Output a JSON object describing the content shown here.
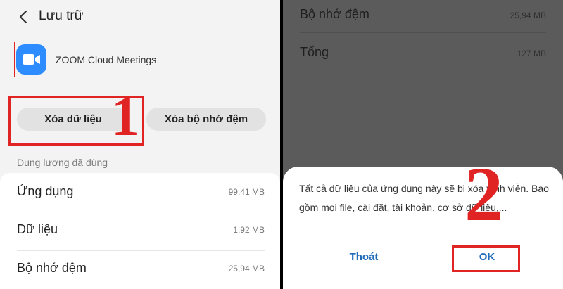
{
  "left": {
    "header": {
      "title": "Lưu trữ",
      "back_icon": "arrow-left-icon"
    },
    "app": {
      "name": "ZOOM Cloud Meetings",
      "icon": "zoom-camera-icon",
      "icon_color": "#2d8cff"
    },
    "buttons": {
      "clear_data": "Xóa dữ liệu",
      "clear_cache": "Xóa bộ nhớ đệm"
    },
    "annotation_step": "1",
    "section_label": "Dung lượng đã dùng",
    "rows": [
      {
        "label": "Ứng dụng",
        "value": "99,41 MB"
      },
      {
        "label": "Dữ liệu",
        "value": "1,92 MB"
      },
      {
        "label": "Bộ nhớ đệm",
        "value": "25,94 MB"
      }
    ]
  },
  "right": {
    "rows": [
      {
        "label": "Bộ nhớ đệm",
        "value": "25,94 MB"
      },
      {
        "label": "Tổng",
        "value": "127 MB"
      }
    ],
    "dialog": {
      "message": "Tất cả dữ liệu của ứng dụng này sẽ bị xóa vĩnh viễn. Bao gồm mọi file, cài đặt, tài khoản, cơ sở dữ liệu,...",
      "cancel_label": "Thoát",
      "ok_label": "OK"
    },
    "annotation_step": "2"
  },
  "colors": {
    "annotation": "#e02424",
    "accent": "#1f6bb8",
    "dim_overlay": "#5b5b5b"
  }
}
